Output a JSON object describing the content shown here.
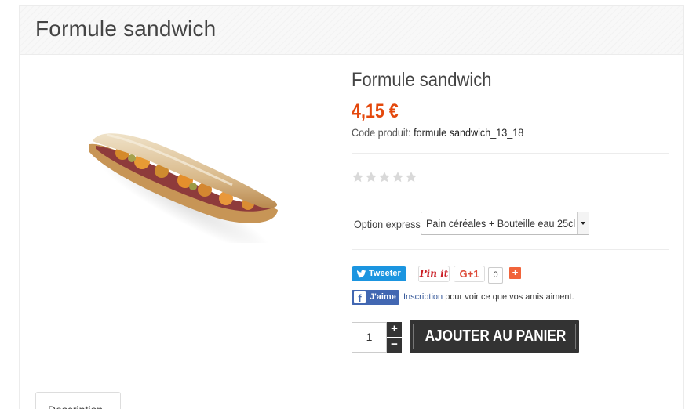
{
  "header": {
    "title": "Formule sandwich"
  },
  "product": {
    "name": "Formule sandwich",
    "price": "4,15 €",
    "reference_label": "Code produit:",
    "reference_value": "formule sandwich_13_18",
    "rating_stars": 5,
    "rating_value": 0
  },
  "option": {
    "label": "Option express",
    "selected": "Pain céréales + Bouteille eau 25cl"
  },
  "social": {
    "tweet_label": "Tweeter",
    "pin_label": "Pin it",
    "gplus_label": "G+1",
    "gplus_count": "0",
    "add_label": "+",
    "like_label": "J'aime",
    "like_link": "Inscription",
    "like_text": " pour voir ce que vos amis aiment."
  },
  "cart": {
    "quantity": "1",
    "plus_label": "+",
    "minus_label": "−",
    "add_to_cart_label": "AJOUTER AU PANIER"
  },
  "tabs": [
    {
      "label": "Description"
    }
  ],
  "colors": {
    "price": "#e4480c",
    "twitter": "#1b95e0",
    "facebook": "#4267b2",
    "pinterest": "#cb2027",
    "gplus": "#dd4b39",
    "cart_button": "#333333"
  }
}
